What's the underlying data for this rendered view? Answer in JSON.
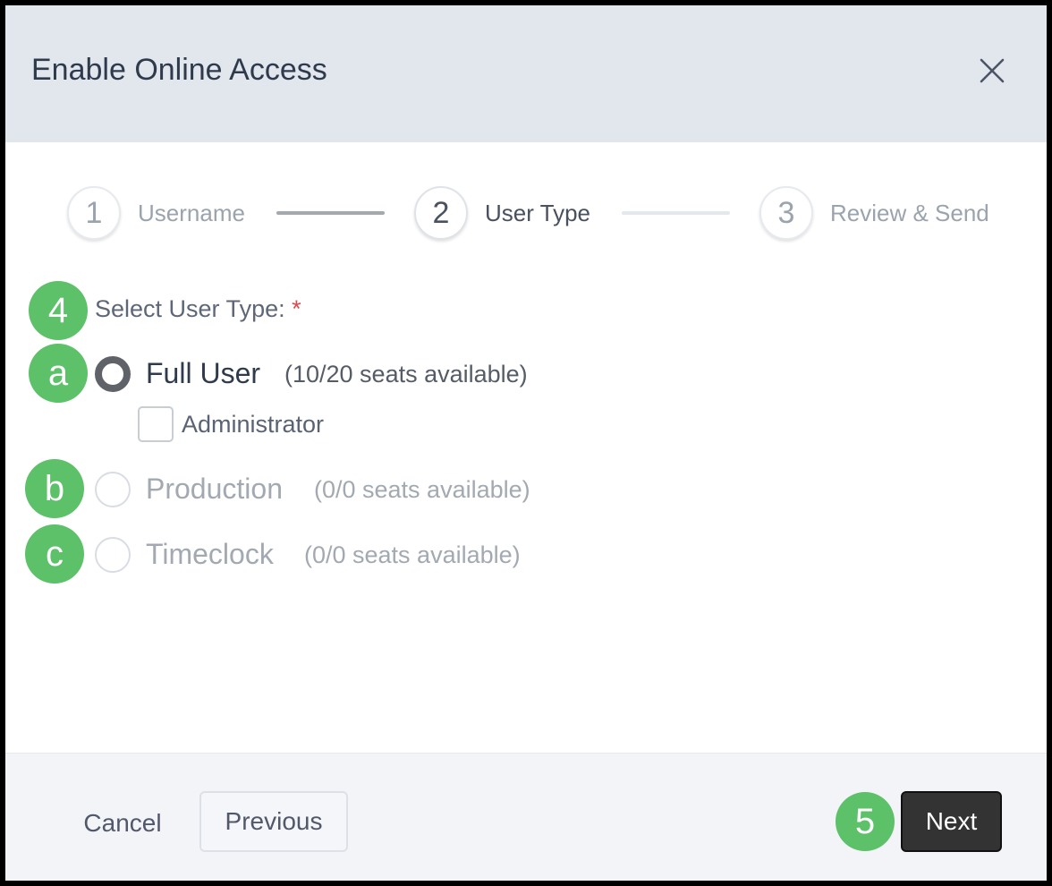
{
  "modal": {
    "title": "Enable Online Access",
    "close_icon": "close-icon"
  },
  "stepper": {
    "steps": [
      {
        "number": "1",
        "label": "Username",
        "state": "complete"
      },
      {
        "number": "2",
        "label": "User Type",
        "state": "active"
      },
      {
        "number": "3",
        "label": "Review & Send",
        "state": "upcoming"
      }
    ]
  },
  "form": {
    "label": "Select User Type:",
    "required_marker": "*",
    "options": [
      {
        "name": "Full User",
        "seats": "(10/20 seats available)",
        "selected": true,
        "disabled": false
      },
      {
        "name": "Production",
        "seats": "(0/0 seats available)",
        "selected": false,
        "disabled": true
      },
      {
        "name": "Timeclock",
        "seats": "(0/0 seats available)",
        "selected": false,
        "disabled": true
      }
    ],
    "admin_checkbox": {
      "label": "Administrator",
      "checked": false
    }
  },
  "annotations": {
    "badge_4": "4",
    "badge_a": "a",
    "badge_b": "b",
    "badge_c": "c",
    "badge_5": "5"
  },
  "footer": {
    "cancel_label": "Cancel",
    "previous_label": "Previous",
    "next_label": "Next"
  },
  "colors": {
    "header_bg": "#e2e7ee",
    "badge_green": "#5cc168",
    "primary_button": "#333333",
    "required_red": "#e04848"
  }
}
